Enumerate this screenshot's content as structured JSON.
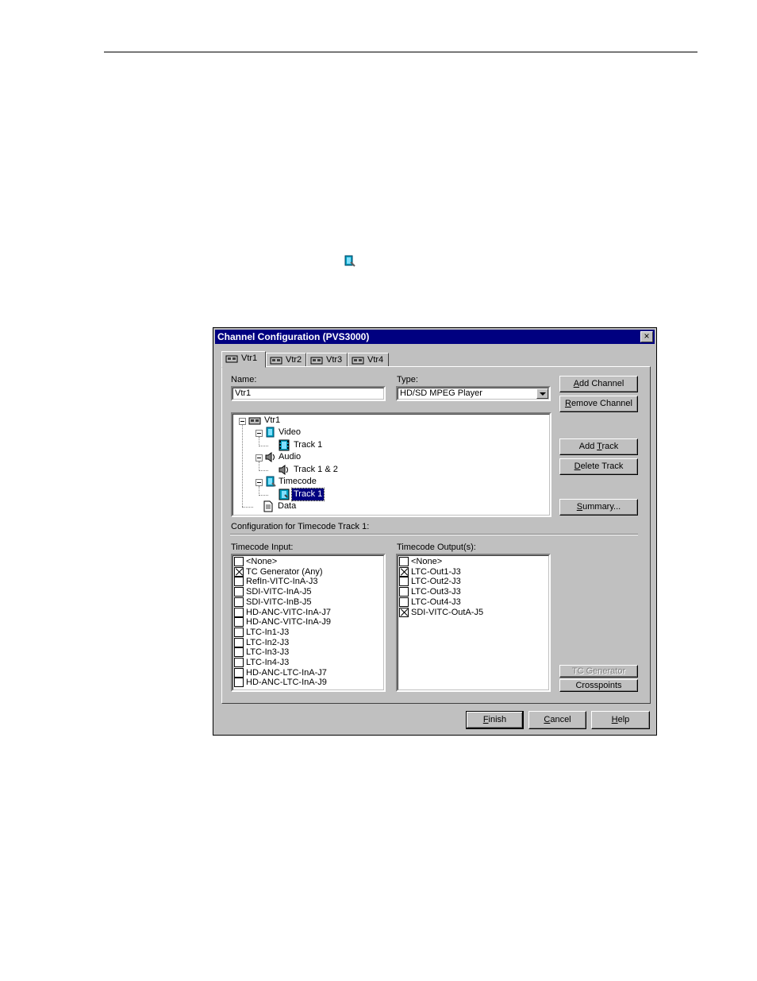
{
  "dialog": {
    "title": "Channel Configuration (PVS3000)",
    "close_glyph": "×"
  },
  "tabs": [
    {
      "label": "Vtr1",
      "icon": "vtr-icon"
    },
    {
      "label": "Vtr2",
      "icon": "vtr-icon"
    },
    {
      "label": "Vtr3",
      "icon": "vtr-icon"
    },
    {
      "label": "Vtr4",
      "icon": "vtr-icon"
    }
  ],
  "form": {
    "name_label": "Name:",
    "name_value": "Vtr1",
    "type_label": "Type:",
    "type_value": "HD/SD MPEG Player"
  },
  "buttons": {
    "add_channel": {
      "pre": "",
      "key": "A",
      "post": "dd Channel"
    },
    "remove_channel": {
      "pre": "",
      "key": "R",
      "post": "emove Channel"
    },
    "add_track": {
      "pre": "Add ",
      "key": "T",
      "post": "rack"
    },
    "delete_track": {
      "pre": "",
      "key": "D",
      "post": "elete Track"
    },
    "summary": {
      "pre": "",
      "key": "S",
      "post": "ummary..."
    },
    "tc_generator": "TC Generator",
    "crosspoints": "Crosspoints",
    "finish": {
      "pre": "",
      "key": "F",
      "post": "inish"
    },
    "cancel": {
      "pre": "",
      "key": "C",
      "post": "ancel"
    },
    "help": {
      "pre": "",
      "key": "H",
      "post": "elp"
    }
  },
  "tree": {
    "root": {
      "label": "Vtr1",
      "icon": "vtr-icon"
    },
    "video": {
      "label": "Video",
      "icon": "video-icon"
    },
    "video_track": {
      "label": "Track 1",
      "icon": "film-track-icon"
    },
    "audio": {
      "label": "Audio",
      "icon": "speaker-icon"
    },
    "audio_track": {
      "label": "Track 1 & 2",
      "icon": "speaker-icon"
    },
    "timecode": {
      "label": "Timecode",
      "icon": "timecode-icon"
    },
    "timecode_track": {
      "label": "Track 1",
      "icon": "timecode-track-icon"
    },
    "data": {
      "label": "Data",
      "icon": "data-icon"
    }
  },
  "config_label": "Configuration for Timecode Track 1:",
  "timecode_input": {
    "label": "Timecode Input:",
    "items": [
      {
        "label": "<None>",
        "checked": false
      },
      {
        "label": "TC Generator (Any)",
        "checked": true
      },
      {
        "label": "RefIn-VITC-InA-J3",
        "checked": false
      },
      {
        "label": "SDI-VITC-InA-J5",
        "checked": false
      },
      {
        "label": "SDI-VITC-InB-J5",
        "checked": false
      },
      {
        "label": "HD-ANC-VITC-InA-J7",
        "checked": false
      },
      {
        "label": "HD-ANC-VITC-InA-J9",
        "checked": false
      },
      {
        "label": "LTC-In1-J3",
        "checked": false
      },
      {
        "label": "LTC-In2-J3",
        "checked": false
      },
      {
        "label": "LTC-In3-J3",
        "checked": false
      },
      {
        "label": "LTC-In4-J3",
        "checked": false
      },
      {
        "label": "HD-ANC-LTC-InA-J7",
        "checked": false
      },
      {
        "label": "HD-ANC-LTC-InA-J9",
        "checked": false
      }
    ]
  },
  "timecode_output": {
    "label": "Timecode Output(s):",
    "items": [
      {
        "label": "<None>",
        "checked": false
      },
      {
        "label": "LTC-Out1-J3",
        "checked": true
      },
      {
        "label": "LTC-Out2-J3",
        "checked": false
      },
      {
        "label": "LTC-Out3-J3",
        "checked": false
      },
      {
        "label": "LTC-Out4-J3",
        "checked": false
      },
      {
        "label": "SDI-VITC-OutA-J5",
        "checked": true
      }
    ]
  },
  "colors": {
    "titlebar": "#000080",
    "dialog_face": "#c0c0c0",
    "selection": "#000080"
  }
}
